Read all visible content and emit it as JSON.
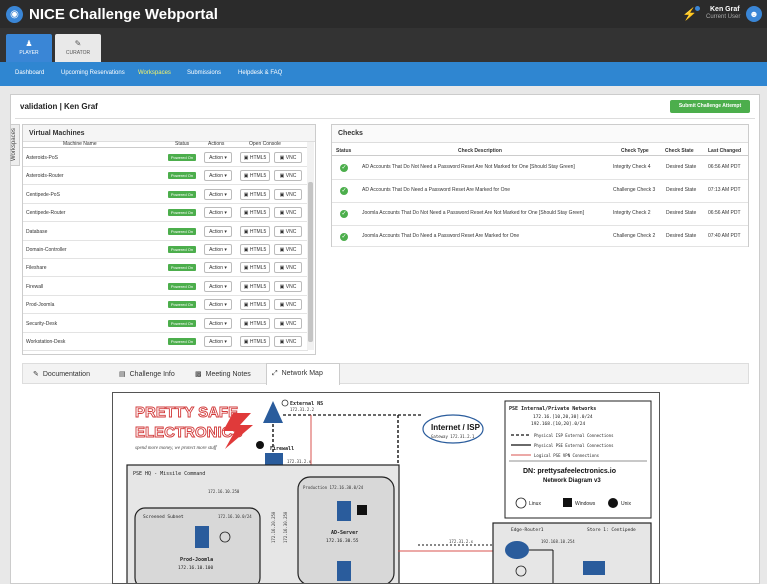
{
  "app": {
    "title": "NICE Challenge Webportal",
    "user_name": "Ken Graf",
    "user_role": "Current User"
  },
  "role_tabs": [
    {
      "label": "PLAYER"
    },
    {
      "label": "CURATOR"
    }
  ],
  "nav": [
    "Dashboard",
    "Upcoming Reservations",
    "Workspaces",
    "Submissions",
    "Helpdesk & FAQ"
  ],
  "side_label": "Workspaces",
  "workspace": {
    "title": "validation | Ken Graf",
    "submit_label": "Submit Challenge Attempt"
  },
  "vm_panel": {
    "title": "Virtual Machines",
    "headers": [
      "Machine Name",
      "Status",
      "Actions",
      "Open Console"
    ],
    "action_label": "Action ▾",
    "html5_label": "HTML5",
    "vnc_label": "VNC",
    "machines": [
      {
        "name": "Asteroids-PoS",
        "status": "Powered On"
      },
      {
        "name": "Asteroids-Router",
        "status": "Powered On"
      },
      {
        "name": "Centipede-PoS",
        "status": "Powered On"
      },
      {
        "name": "Centipede-Router",
        "status": "Powered On"
      },
      {
        "name": "Database",
        "status": "Powered On"
      },
      {
        "name": "Domain-Controller",
        "status": "Powered On"
      },
      {
        "name": "Fileshare",
        "status": "Powered On"
      },
      {
        "name": "Firewall",
        "status": "Powered On"
      },
      {
        "name": "Prod-Joomla",
        "status": "Powered On"
      },
      {
        "name": "Security-Desk",
        "status": "Powered On"
      },
      {
        "name": "Workstation-Desk",
        "status": "Powered On"
      }
    ]
  },
  "checks_panel": {
    "title": "Checks",
    "headers": [
      "Status",
      "Check Description",
      "Check Type",
      "Check State",
      "Last Changed"
    ],
    "rows": [
      {
        "description": "AD Accounts That Do Not Need a Password Reset Are Not Marked for One [Should Stay Green]",
        "type": "Integrity Check 4",
        "state": "Desired State",
        "changed": "06:56 AM PDT"
      },
      {
        "description": "AD Accounts That Do Need a Password Reset Are Marked for One",
        "type": "Challenge Check 3",
        "state": "Desired State",
        "changed": "07:13 AM PDT"
      },
      {
        "description": "Joomla Accounts That Do Not Need a Password Reset Are Not Marked for One [Should Stay Green]",
        "type": "Integrity Check 2",
        "state": "Desired State",
        "changed": "06:56 AM PDT"
      },
      {
        "description": "Joomla Accounts That Do Need a Password Reset Are Marked for One",
        "type": "Challenge Check 2",
        "state": "Desired State",
        "changed": "07:40 AM PDT"
      }
    ]
  },
  "bottom_tabs": [
    "Documentation",
    "Challenge Info",
    "Meeting Notes",
    "Network Map"
  ],
  "network_map": {
    "logo_line1": "PRETTY SAFE",
    "logo_line2": "ELECTRONICS",
    "slogan": "spend more money, we protect more stuff",
    "external_ns": "External NS",
    "ns_ip": "172.31.2.2",
    "internet": "Internet / ISP",
    "gateway": "Gateway 172.31.2.1",
    "firewall": "Firewall",
    "fw_ip": "172.31.2.x",
    "hq_title": "PSE HQ - Missile Command",
    "hq_ip": "172.16.10.250",
    "screened_subnet": "Screened Subnet",
    "screened_ip": "172.16.10.0/24",
    "prod_joomla": "Prod-Joomla",
    "prod_joomla_ip": "172.16.10.100",
    "production": "Production 172.16.30.0/24",
    "ad_server": "AD-Server",
    "ad_ip": "172.16.30.55",
    "vertical_ip1": "172.16.20.250",
    "vertical_ip2": "172.16.30.250",
    "legend_title": "PSE Internal/Private Networks",
    "legend_nets": "172.16.[10,20,30].0/24",
    "legend_nets2": "192.168.[10,20].0/24",
    "legend_isp": "Physical ISP External Connections",
    "legend_pse": "Physical PSE External Connections",
    "legend_vpn": "Logical PSE VPN Connections",
    "dn": "DN: prettysafeelectronics.io",
    "diagram_ver": "Network Diagram v3",
    "os_linux": "Linux",
    "os_windows": "Windows",
    "os_unix": "Unix",
    "edge_router": "Edge-Router1",
    "store": "Store 1: Centipede",
    "store_ip": "192.168.10.254",
    "router_ip": "172.31.2.x"
  },
  "colors": {
    "accent": "#2f86d1",
    "success": "#4cae4c",
    "topbar": "#2b2b2b",
    "link_active": "#f3f36a",
    "vpn_line": "#d9534f"
  }
}
